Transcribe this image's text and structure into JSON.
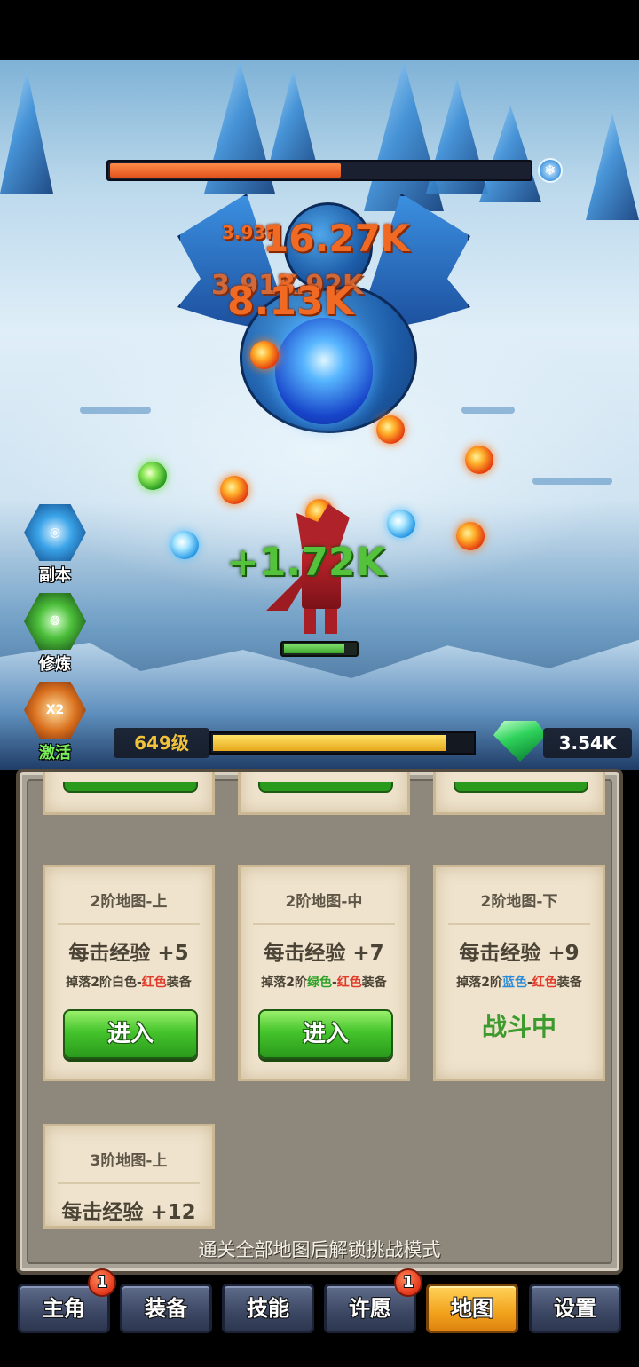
{
  "battle": {
    "boss_hp_fraction": 0.55,
    "boss_element_icon": "snowflake-icon",
    "damage_numbers": [
      "3.93K",
      "16.27K",
      "3.91K",
      "3.92K",
      "8.13K"
    ],
    "heal_number": "+1.72K",
    "hero_hp_fraction": 0.85
  },
  "side_buttons": [
    {
      "label": "副本",
      "icon": "vortex-icon"
    },
    {
      "label": "修炼",
      "icon": "swirl-icon"
    },
    {
      "label": "激活",
      "icon": "x2-boost-icon",
      "badge_text": "X2"
    }
  ],
  "status": {
    "level": "649级",
    "xp_fraction": 0.9,
    "gems": "3.54K",
    "gem_icon": "diamond-icon"
  },
  "maps": [
    {
      "title": "2阶地图-上",
      "exp": "每击经验 +5",
      "drop_prefix": "掉落2阶",
      "drop_c1": "白色",
      "drop_dash": "-",
      "drop_c2": "红色",
      "drop_suffix": "装备",
      "action": "进入"
    },
    {
      "title": "2阶地图-中",
      "exp": "每击经验 +7",
      "drop_prefix": "掉落2阶",
      "drop_c1": "绿色",
      "drop_dash": "-",
      "drop_c2": "红色",
      "drop_suffix": "装备",
      "action": "进入"
    },
    {
      "title": "2阶地图-下",
      "exp": "每击经验 +9",
      "drop_prefix": "掉落2阶",
      "drop_c1": "蓝色",
      "drop_dash": "-",
      "drop_c2": "红色",
      "drop_suffix": "装备",
      "status": "战斗中"
    },
    {
      "title": "3阶地图-上",
      "exp": "每击经验 +12"
    }
  ],
  "unlock_hint": "通关全部地图后解锁挑战模式",
  "nav": [
    {
      "label": "主角",
      "badge": "1"
    },
    {
      "label": "装备"
    },
    {
      "label": "技能"
    },
    {
      "label": "许愿",
      "badge": "1"
    },
    {
      "label": "地图",
      "active": true
    },
    {
      "label": "设置"
    }
  ],
  "colors": {
    "accent_orange": "#f2a21c",
    "damage": "#f06a24",
    "heal": "#55c23c",
    "enter_button": "#45c42c"
  }
}
